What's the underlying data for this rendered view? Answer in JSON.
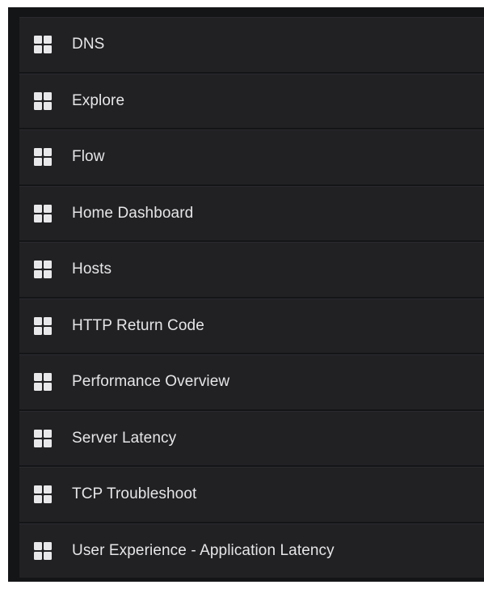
{
  "dashboard_list": {
    "items": [
      {
        "label": "DNS",
        "icon": "dashboard-grid-icon"
      },
      {
        "label": "Explore",
        "icon": "dashboard-grid-icon"
      },
      {
        "label": "Flow",
        "icon": "dashboard-grid-icon"
      },
      {
        "label": "Home Dashboard",
        "icon": "dashboard-grid-icon"
      },
      {
        "label": "Hosts",
        "icon": "dashboard-grid-icon"
      },
      {
        "label": "HTTP Return Code",
        "icon": "dashboard-grid-icon"
      },
      {
        "label": "Performance Overview",
        "icon": "dashboard-grid-icon"
      },
      {
        "label": "Server Latency",
        "icon": "dashboard-grid-icon"
      },
      {
        "label": "TCP Troubleshoot",
        "icon": "dashboard-grid-icon"
      },
      {
        "label": "User Experience - Application Latency",
        "icon": "dashboard-grid-icon"
      }
    ]
  },
  "colors": {
    "panel_background": "#141517",
    "row_background": "#212124",
    "text": "#e6e6e8",
    "icon": "#e8e8ea"
  }
}
